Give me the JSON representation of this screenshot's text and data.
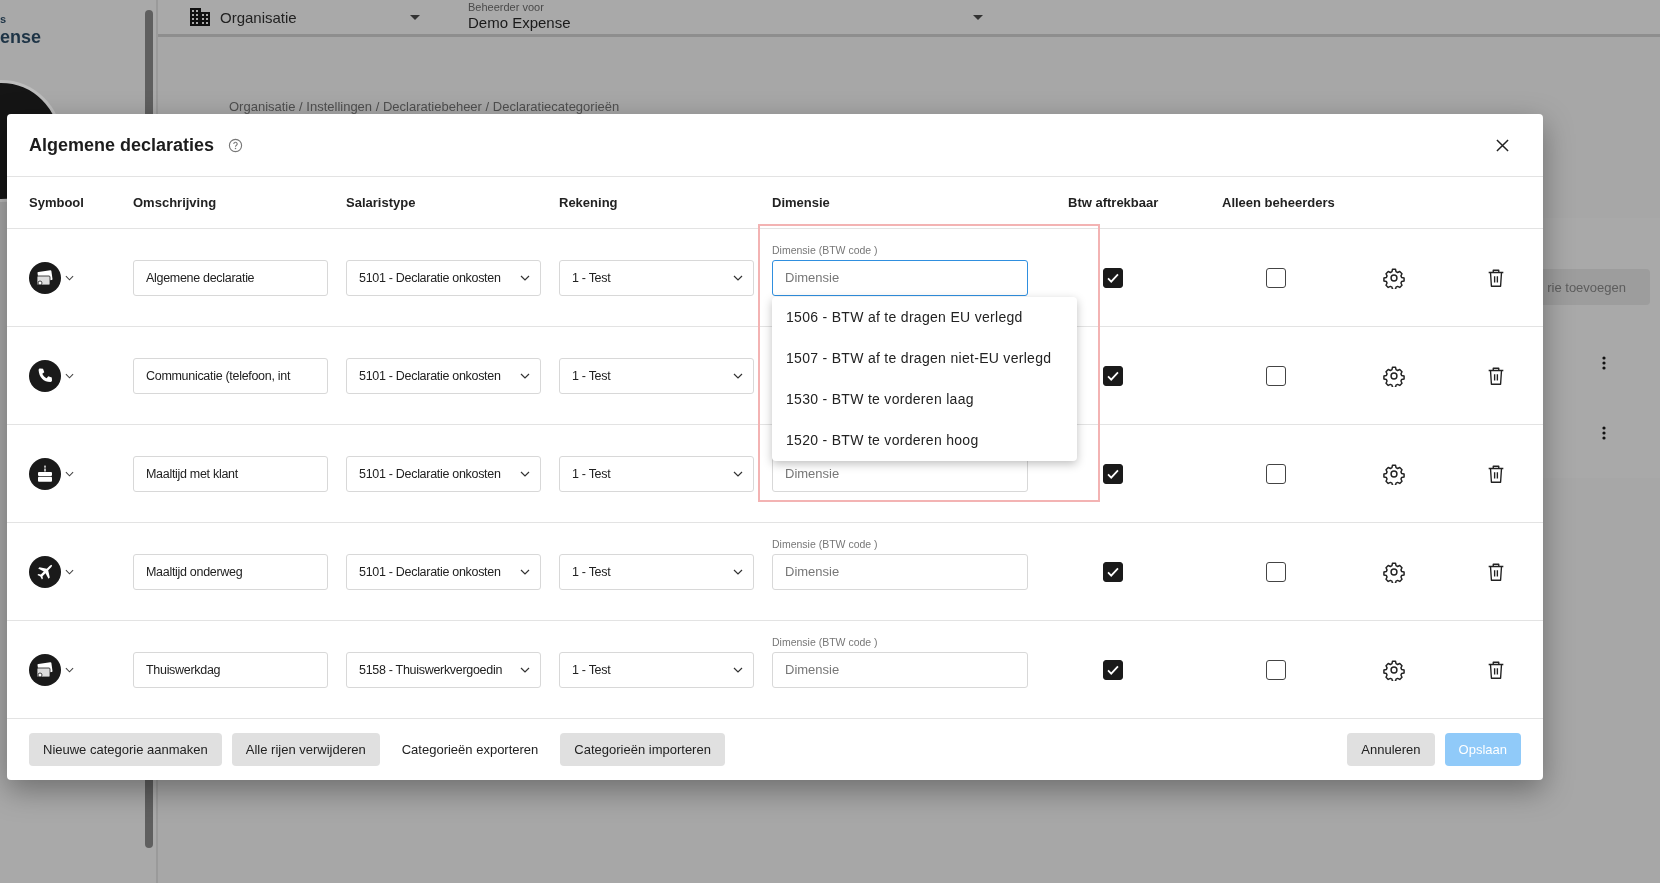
{
  "background": {
    "sidebar": {
      "brand_lines": [
        "s",
        "ense"
      ]
    },
    "top_bar": {
      "organisation_select": "Organisatie",
      "admin_label": "Beheerder voor",
      "admin_value": "Demo Expense"
    },
    "breadcrumb": "Organisatie / Instellingen / Declaratiebeheer / Declaratiecategorieën",
    "add_button": "rie toevoegen"
  },
  "dialog": {
    "title": "Algemene declaraties",
    "dimension_highlight": true,
    "columns": [
      "Symbool",
      "Omschrijving",
      "Salaristype",
      "Rekening",
      "Dimensie",
      "Btw aftrekbaar",
      "Alleen beheerders"
    ],
    "rows": [
      {
        "kind": "cards",
        "description": "Algemene declaratie",
        "salary_type": "5101 - Declaratie onkosten",
        "account": "1 - Test",
        "dimension": {
          "label": "Dimensie (BTW code )",
          "placeholder": "Dimensie",
          "focused": true,
          "options": [
            "1506 - BTW af te dragen EU verlegd",
            "1507 - BTW af te dragen niet-EU verlegd",
            "1530 - BTW te vorderen laag",
            "1520 - BTW te vorderen hoog"
          ]
        },
        "vat_deductible": true,
        "admins_only": false
      },
      {
        "kind": "phone",
        "description": "Communicatie (telefoon, int",
        "salary_type": "5101 - Declaratie onkosten",
        "account": "1 - Test",
        "vat_deductible": true,
        "admins_only": false
      },
      {
        "kind": "cake",
        "description": "Maaltijd met klant",
        "salary_type": "5101 - Declaratie onkosten",
        "account": "1 - Test",
        "dimension": {
          "placeholder": "Dimensie",
          "focused": false
        },
        "vat_deductible": true,
        "admins_only": false
      },
      {
        "kind": "plane",
        "description": "Maaltijd onderweg",
        "salary_type": "5101 - Declaratie onkosten",
        "account": "1 - Test",
        "dimension": {
          "label": "Dimensie (BTW code )",
          "placeholder": "Dimensie",
          "focused": false
        },
        "vat_deductible": true,
        "admins_only": false
      },
      {
        "kind": "cards",
        "description": "Thuiswerkdag",
        "salary_type": "5158 - Thuiswerkvergoedin",
        "account": "1 - Test",
        "dimension": {
          "label": "Dimensie (BTW code )",
          "placeholder": "Dimensie",
          "focused": false
        },
        "vat_deductible": true,
        "admins_only": false
      }
    ],
    "footer_left": [
      {
        "kind": "filled",
        "label": "Nieuwe categorie aanmaken",
        "disabled": false
      },
      {
        "kind": "filled",
        "label": "Alle rijen verwijderen",
        "disabled": false
      },
      {
        "kind": "text",
        "label": "Categorieën exporteren",
        "disabled": false
      },
      {
        "kind": "filled",
        "label": "Categorieën importeren",
        "disabled": false
      }
    ],
    "footer_right": [
      {
        "kind": "filled",
        "label": "Annuleren",
        "disabled": false
      },
      {
        "kind": "primary",
        "label": "Opslaan",
        "disabled": true
      }
    ]
  }
}
